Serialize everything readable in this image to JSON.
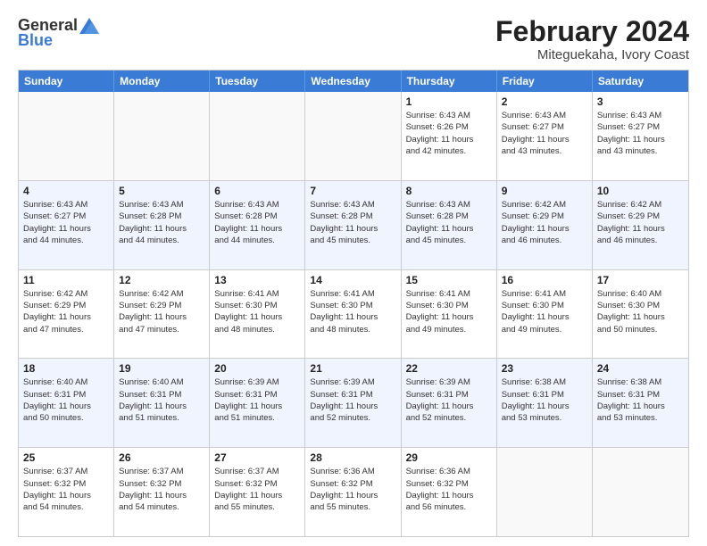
{
  "logo": {
    "general": "General",
    "blue": "Blue"
  },
  "title": "February 2024",
  "subtitle": "Miteguekaha, Ivory Coast",
  "header_days": [
    "Sunday",
    "Monday",
    "Tuesday",
    "Wednesday",
    "Thursday",
    "Friday",
    "Saturday"
  ],
  "weeks": [
    [
      {
        "day": "",
        "info": ""
      },
      {
        "day": "",
        "info": ""
      },
      {
        "day": "",
        "info": ""
      },
      {
        "day": "",
        "info": ""
      },
      {
        "day": "1",
        "info": "Sunrise: 6:43 AM\nSunset: 6:26 PM\nDaylight: 11 hours\nand 42 minutes."
      },
      {
        "day": "2",
        "info": "Sunrise: 6:43 AM\nSunset: 6:27 PM\nDaylight: 11 hours\nand 43 minutes."
      },
      {
        "day": "3",
        "info": "Sunrise: 6:43 AM\nSunset: 6:27 PM\nDaylight: 11 hours\nand 43 minutes."
      }
    ],
    [
      {
        "day": "4",
        "info": "Sunrise: 6:43 AM\nSunset: 6:27 PM\nDaylight: 11 hours\nand 44 minutes."
      },
      {
        "day": "5",
        "info": "Sunrise: 6:43 AM\nSunset: 6:28 PM\nDaylight: 11 hours\nand 44 minutes."
      },
      {
        "day": "6",
        "info": "Sunrise: 6:43 AM\nSunset: 6:28 PM\nDaylight: 11 hours\nand 44 minutes."
      },
      {
        "day": "7",
        "info": "Sunrise: 6:43 AM\nSunset: 6:28 PM\nDaylight: 11 hours\nand 45 minutes."
      },
      {
        "day": "8",
        "info": "Sunrise: 6:43 AM\nSunset: 6:28 PM\nDaylight: 11 hours\nand 45 minutes."
      },
      {
        "day": "9",
        "info": "Sunrise: 6:42 AM\nSunset: 6:29 PM\nDaylight: 11 hours\nand 46 minutes."
      },
      {
        "day": "10",
        "info": "Sunrise: 6:42 AM\nSunset: 6:29 PM\nDaylight: 11 hours\nand 46 minutes."
      }
    ],
    [
      {
        "day": "11",
        "info": "Sunrise: 6:42 AM\nSunset: 6:29 PM\nDaylight: 11 hours\nand 47 minutes."
      },
      {
        "day": "12",
        "info": "Sunrise: 6:42 AM\nSunset: 6:29 PM\nDaylight: 11 hours\nand 47 minutes."
      },
      {
        "day": "13",
        "info": "Sunrise: 6:41 AM\nSunset: 6:30 PM\nDaylight: 11 hours\nand 48 minutes."
      },
      {
        "day": "14",
        "info": "Sunrise: 6:41 AM\nSunset: 6:30 PM\nDaylight: 11 hours\nand 48 minutes."
      },
      {
        "day": "15",
        "info": "Sunrise: 6:41 AM\nSunset: 6:30 PM\nDaylight: 11 hours\nand 49 minutes."
      },
      {
        "day": "16",
        "info": "Sunrise: 6:41 AM\nSunset: 6:30 PM\nDaylight: 11 hours\nand 49 minutes."
      },
      {
        "day": "17",
        "info": "Sunrise: 6:40 AM\nSunset: 6:30 PM\nDaylight: 11 hours\nand 50 minutes."
      }
    ],
    [
      {
        "day": "18",
        "info": "Sunrise: 6:40 AM\nSunset: 6:31 PM\nDaylight: 11 hours\nand 50 minutes."
      },
      {
        "day": "19",
        "info": "Sunrise: 6:40 AM\nSunset: 6:31 PM\nDaylight: 11 hours\nand 51 minutes."
      },
      {
        "day": "20",
        "info": "Sunrise: 6:39 AM\nSunset: 6:31 PM\nDaylight: 11 hours\nand 51 minutes."
      },
      {
        "day": "21",
        "info": "Sunrise: 6:39 AM\nSunset: 6:31 PM\nDaylight: 11 hours\nand 52 minutes."
      },
      {
        "day": "22",
        "info": "Sunrise: 6:39 AM\nSunset: 6:31 PM\nDaylight: 11 hours\nand 52 minutes."
      },
      {
        "day": "23",
        "info": "Sunrise: 6:38 AM\nSunset: 6:31 PM\nDaylight: 11 hours\nand 53 minutes."
      },
      {
        "day": "24",
        "info": "Sunrise: 6:38 AM\nSunset: 6:31 PM\nDaylight: 11 hours\nand 53 minutes."
      }
    ],
    [
      {
        "day": "25",
        "info": "Sunrise: 6:37 AM\nSunset: 6:32 PM\nDaylight: 11 hours\nand 54 minutes."
      },
      {
        "day": "26",
        "info": "Sunrise: 6:37 AM\nSunset: 6:32 PM\nDaylight: 11 hours\nand 54 minutes."
      },
      {
        "day": "27",
        "info": "Sunrise: 6:37 AM\nSunset: 6:32 PM\nDaylight: 11 hours\nand 55 minutes."
      },
      {
        "day": "28",
        "info": "Sunrise: 6:36 AM\nSunset: 6:32 PM\nDaylight: 11 hours\nand 55 minutes."
      },
      {
        "day": "29",
        "info": "Sunrise: 6:36 AM\nSunset: 6:32 PM\nDaylight: 11 hours\nand 56 minutes."
      },
      {
        "day": "",
        "info": ""
      },
      {
        "day": "",
        "info": ""
      }
    ]
  ]
}
